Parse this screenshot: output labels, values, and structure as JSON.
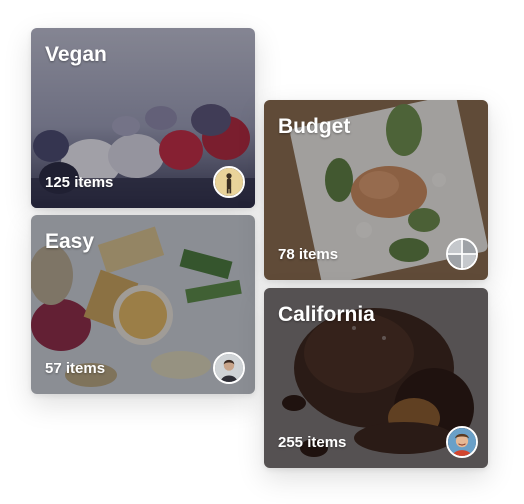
{
  "cards": [
    {
      "title": "Vegan",
      "count": "125 items",
      "image": "frozen-berries-photo",
      "avatar": "user-avatar-standing-figure"
    },
    {
      "title": "Easy",
      "count": "57 items",
      "image": "appetizer-platter-photo",
      "avatar": "user-avatar-portrait"
    },
    {
      "title": "Budget",
      "count": "78 items",
      "image": "plated-salad-photo",
      "avatar": "user-avatar-grid"
    },
    {
      "title": "California",
      "count": "255 items",
      "image": "chocolate-lava-cake-photo",
      "avatar": "user-avatar-smiling"
    }
  ],
  "colors": {
    "overlay": "#0a0a14",
    "text": "#ffffff"
  }
}
